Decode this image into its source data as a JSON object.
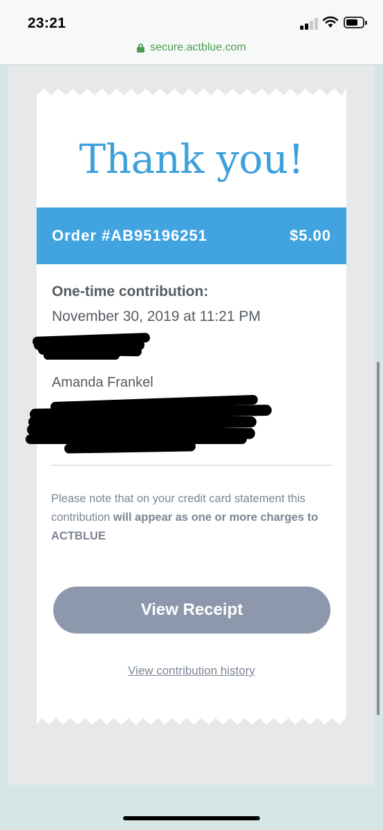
{
  "status": {
    "time": "23:21",
    "icons": [
      "signal-icon",
      "wifi-icon",
      "battery-icon"
    ]
  },
  "browser": {
    "url": "secure.actblue.com",
    "lock_icon": "lock-icon"
  },
  "receipt": {
    "heading": "Thank you!",
    "order_label": "Order #AB95196251",
    "amount": "$5.00",
    "contribution_label": "One-time contribution:",
    "contribution_date": "November 30, 2019 at 11:21 PM",
    "donor_name": "Amanda Frankel",
    "note_part1": "Please note that on your credit card statement this contribution ",
    "note_bold": "will appear as one or more charges to ACTBLUE",
    "button_label": "View Receipt",
    "history_link": "View contribution history"
  },
  "colors": {
    "accent_blue": "#41a3e0",
    "heading_blue": "#3fa0dc",
    "button_gray": "#8d98ac",
    "secure_green": "#4a9c4f"
  }
}
